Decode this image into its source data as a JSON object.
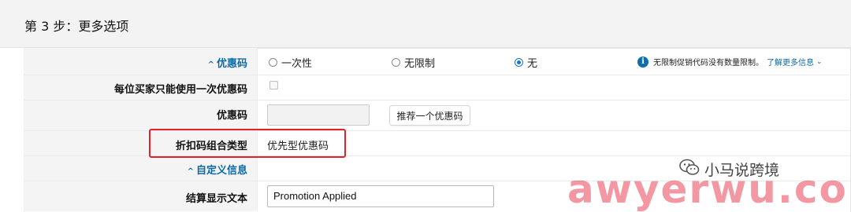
{
  "step": {
    "title": "第 3 步：更多选项"
  },
  "rows": {
    "coupon_section": {
      "label": "优惠码",
      "caret": "^"
    },
    "one_per_buyer": {
      "label": "每位买家只能使用一次优惠码"
    },
    "coupon_code": {
      "label": "优惠码",
      "suggest_button": "推荐一个优惠码",
      "value": ""
    },
    "combo_type": {
      "label": "折扣码组合类型",
      "value": "优先型优惠码"
    },
    "custom_section": {
      "label": "自定义信息",
      "caret": "^"
    },
    "checkout_text": {
      "label": "结算显示文本",
      "value": "Promotion Applied"
    }
  },
  "radios": [
    {
      "label": "一次性",
      "selected": false
    },
    {
      "label": "无限制",
      "selected": false
    },
    {
      "label": "无",
      "selected": true
    }
  ],
  "info": {
    "icon": "info-icon",
    "text": "无限制促销代码没有数量限制。",
    "link": "了解更多信息",
    "chevron": "chevron-down-icon"
  },
  "overlay": {
    "wechat_account": "小马说跨境",
    "watermark": "awyerwu.com"
  },
  "colors": {
    "accent": "#1a73c9",
    "link": "#0c6aa6",
    "highlight": "#e0222a"
  }
}
